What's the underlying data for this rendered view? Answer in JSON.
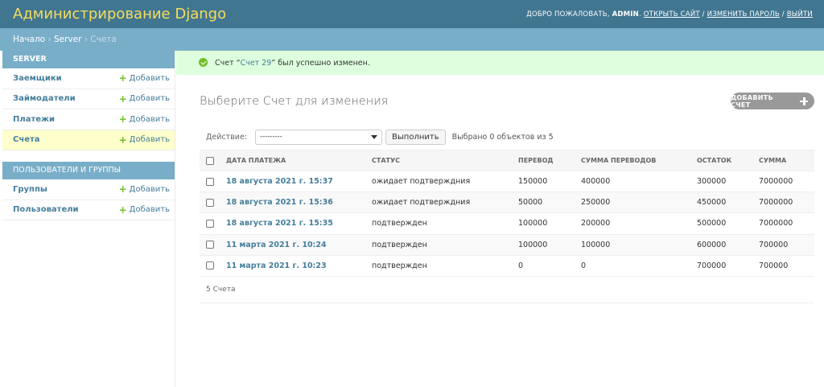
{
  "header": {
    "branding": "Администрирование Django",
    "welcome": "Добро пожаловать,",
    "username": "admin",
    "view_site": "Открыть сайт",
    "change_password": "Изменить пароль",
    "logout": "Выйти"
  },
  "breadcrumbs": {
    "home": "Начало",
    "app": "Server",
    "current": "Счета"
  },
  "sidebar": {
    "modules": [
      {
        "caption": "Server",
        "models": [
          {
            "name": "Заемщики",
            "add": "Добавить"
          },
          {
            "name": "Займодатели",
            "add": "Добавить"
          },
          {
            "name": "Платежи",
            "add": "Добавить"
          },
          {
            "name": "Счета",
            "add": "Добавить"
          }
        ]
      },
      {
        "caption": "Пользователи и группы",
        "models": [
          {
            "name": "Группы",
            "add": "Добавить"
          },
          {
            "name": "Пользователи",
            "add": "Добавить"
          }
        ]
      }
    ]
  },
  "message": {
    "before": "Счет “",
    "link": "Счет 29",
    "after": "” был успешно изменен."
  },
  "content": {
    "title": "Выберите Счет для изменения",
    "add_button": "Добавить Счет"
  },
  "actions": {
    "label": "Действие:",
    "selected": "---------",
    "go": "Выполнить",
    "counter": "Выбрано 0 объектов из 5"
  },
  "table": {
    "columns": [
      "Дата платежа",
      "Статус",
      "Перевод",
      "Сумма переводов",
      "Остаток",
      "Сумма"
    ],
    "rows": [
      [
        "18 августа 2021 г. 15:37",
        "ожидает подтверждния",
        "150000",
        "400000",
        "300000",
        "7000000"
      ],
      [
        "18 августа 2021 г. 15:36",
        "ожидает подтверждния",
        "50000",
        "250000",
        "450000",
        "7000000"
      ],
      [
        "18 августа 2021 г. 15:35",
        "подтвержден",
        "100000",
        "200000",
        "500000",
        "7000000"
      ],
      [
        "11 марта 2021 г. 10:24",
        "подтвержден",
        "100000",
        "100000",
        "600000",
        "700000"
      ],
      [
        "11 марта 2021 г. 10:23",
        "подтвержден",
        "0",
        "0",
        "700000",
        "700000"
      ]
    ]
  },
  "paginator": "5 Счета",
  "colors": {
    "header_bg": "#417690",
    "branding": "#f5dd5d",
    "breadcrumbs_bg": "#79aec8",
    "link": "#447e9b",
    "success_bg": "#ddffdd",
    "add_green": "#70bf2b"
  }
}
